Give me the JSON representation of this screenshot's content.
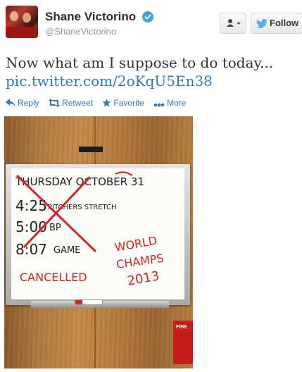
{
  "header": {
    "display_name": "Shane Victorino",
    "handle": "@ShaneVictorino",
    "follow_label": "Follow",
    "accent": "#2b7bb9"
  },
  "tweet": {
    "text": "Now what am I suppose to do today...",
    "link": "pic.twitter.com/2oKqU5En38"
  },
  "actions": {
    "reply": "Reply",
    "retweet": "Retweet",
    "favorite": "Favorite",
    "more": "More"
  },
  "photo": {
    "board_lines": {
      "line1": "THURSDAY OCTOBER 31",
      "line2_time": "4:25",
      "line2_text": "PITCHERS STRETCH",
      "line3_time": "5:00",
      "line3_text": "BP",
      "line4_time": "8:07",
      "line4_text": "GAME",
      "cancelled": "CANCELLED",
      "world": "WORLD",
      "champs": "CHAMPS",
      "year": "2013"
    },
    "alarm_label": "FIRE"
  }
}
